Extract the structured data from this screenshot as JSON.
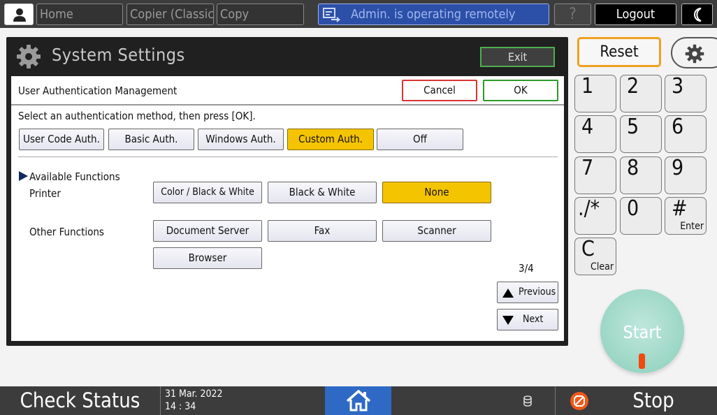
{
  "topbar": {
    "home": "Home",
    "copier_classic": "Copier (Classic)",
    "copy": "Copy",
    "admin_notice": "Admin. is operating remotely",
    "help": "?",
    "logout": "Logout"
  },
  "system_settings": {
    "title": "System Settings",
    "exit": "Exit"
  },
  "dialog": {
    "header": "User Authentication Management",
    "cancel": "Cancel",
    "ok": "OK",
    "instruction": "Select an authentication method, then press [OK].",
    "auth_methods": [
      {
        "label": "User Code Auth.",
        "selected": false
      },
      {
        "label": "Basic Auth.",
        "selected": false
      },
      {
        "label": "Windows Auth.",
        "selected": false
      },
      {
        "label": "Custom Auth.",
        "selected": true
      },
      {
        "label": "Off",
        "selected": false
      }
    ],
    "available_functions": "Available Functions",
    "printer_label": "Printer",
    "printer_options": [
      {
        "label": "Color / Black & White",
        "selected": false
      },
      {
        "label": "Black & White",
        "selected": false
      },
      {
        "label": "None",
        "selected": true
      }
    ],
    "other_label": "Other Functions",
    "other_functions": [
      "Document Server",
      "Fax",
      "Scanner",
      "Browser"
    ],
    "page_indicator": "3/4",
    "previous": "Previous",
    "next": "Next"
  },
  "keypad": {
    "reset": "Reset",
    "keys": [
      {
        "main": "1",
        "sub": ""
      },
      {
        "main": "2",
        "sub": ""
      },
      {
        "main": "3",
        "sub": ""
      },
      {
        "main": "4",
        "sub": ""
      },
      {
        "main": "5",
        "sub": ""
      },
      {
        "main": "6",
        "sub": ""
      },
      {
        "main": "7",
        "sub": ""
      },
      {
        "main": "8",
        "sub": ""
      },
      {
        "main": "9",
        "sub": ""
      },
      {
        "main": "./*",
        "sub": ""
      },
      {
        "main": "0",
        "sub": ""
      },
      {
        "main": "#",
        "sub": "Enter"
      },
      {
        "main": "C",
        "sub": "Clear"
      }
    ],
    "start": "Start"
  },
  "bottombar": {
    "check_status": "Check Status",
    "date": "31 Mar. 2022",
    "time": "14 : 34",
    "stop": "Stop"
  },
  "colors": {
    "selected": "#f5c400",
    "admin_banner": "#2c4fa8",
    "home_button": "#2e69c6",
    "start_button": "#9bd6c5",
    "ok_border": "#2a9a2a",
    "cancel_border": "#d33333",
    "reset_border": "#f0a020"
  },
  "icons": [
    "user-icon",
    "remote-admin-icon",
    "moon-icon",
    "gear-icon",
    "home-icon",
    "data-icon",
    "stop-icon",
    "triangle-right-icon",
    "arrow-up-icon",
    "arrow-down-icon"
  ]
}
